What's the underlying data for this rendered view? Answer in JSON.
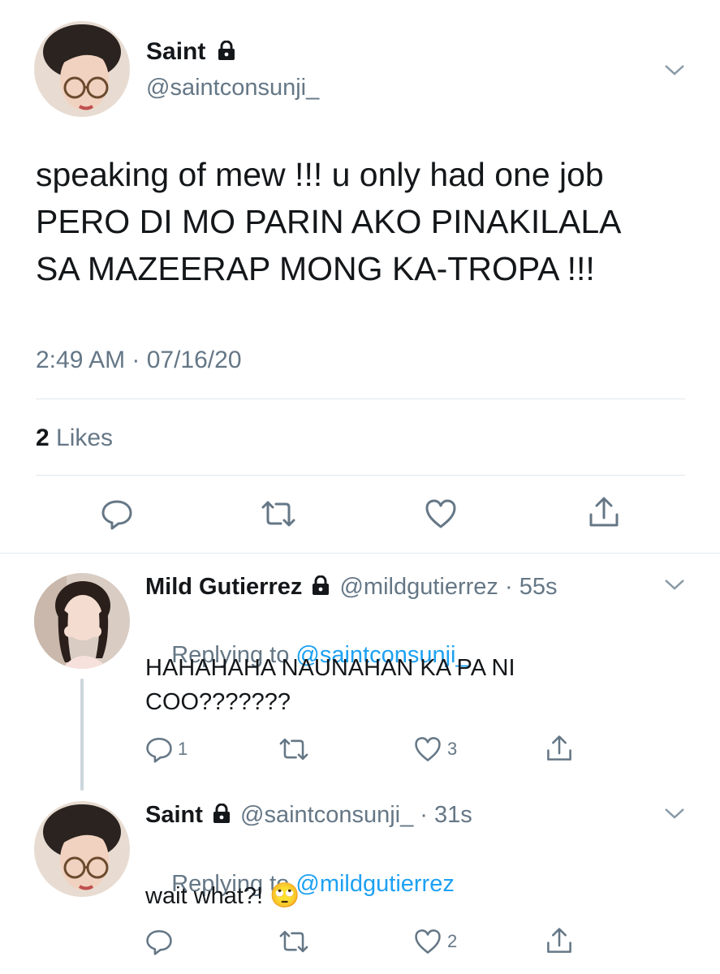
{
  "main_tweet": {
    "display_name": "Saint",
    "handle": "@saintconsunji_",
    "text_lines": [
      "speaking of mew !!! u only had one job",
      "PERO DI MO PARIN AKO PINAKILALA",
      "SA MAZEERAP MONG KA-TROPA !!!"
    ],
    "timestamp": "2:49 AM · 07/16/20",
    "likes_count": "2",
    "likes_label": " Likes"
  },
  "replies": [
    {
      "display_name": "Mild Gutierrez",
      "handle_time": "@mildgutierrez · 55s",
      "replying_prefix": "Replying to ",
      "replying_to": "@saintconsunji_",
      "text_lines": [
        "HAHAHAHA NAUNAHAN KA PA NI",
        "COO???????"
      ],
      "reply_count": "1",
      "retweet_count": "",
      "like_count": "3"
    },
    {
      "display_name": "Saint",
      "handle_time": "@saintconsunji_ · 31s",
      "replying_prefix": "Replying to ",
      "replying_to": "@mildgutierrez",
      "text": "wait what?!",
      "emoji": "🙄",
      "reply_count": "",
      "retweet_count": "",
      "like_count": "2"
    }
  ],
  "icons": {
    "reply": "speech-bubble-icon",
    "retweet": "retweet-arrows-icon",
    "like": "heart-icon",
    "share": "share-arrow-icon",
    "lock": "padlock-icon",
    "menu": "chevron-down-icon"
  },
  "colors": {
    "link": "#1da1f2",
    "muted": "#657786",
    "divider": "#e1e8ed"
  }
}
